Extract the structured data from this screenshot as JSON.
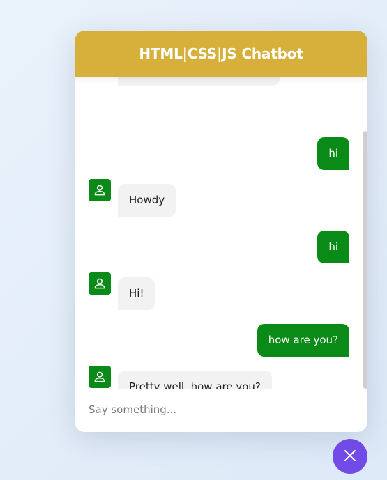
{
  "header": {
    "title": "HTML|CSS|JS Chatbot"
  },
  "messages": [
    {
      "role": "incoming",
      "text": ""
    },
    {
      "role": "outgoing",
      "text": "hi"
    },
    {
      "role": "incoming",
      "text": "Howdy"
    },
    {
      "role": "outgoing",
      "text": "hi"
    },
    {
      "role": "incoming",
      "text": "Hi!"
    },
    {
      "role": "outgoing",
      "text": "how are you?"
    },
    {
      "role": "incoming",
      "text": "Pretty well, how are you?"
    }
  ],
  "input": {
    "placeholder": "Say something..."
  },
  "icons": {
    "avatar": "person-icon",
    "toggler": "close-icon"
  },
  "colors": {
    "header": "#d6b03a",
    "outgoing_bubble": "#0a8a16",
    "incoming_bubble": "#f2f2f2",
    "avatar": "#0a8a16",
    "toggler": "#724ae8"
  }
}
